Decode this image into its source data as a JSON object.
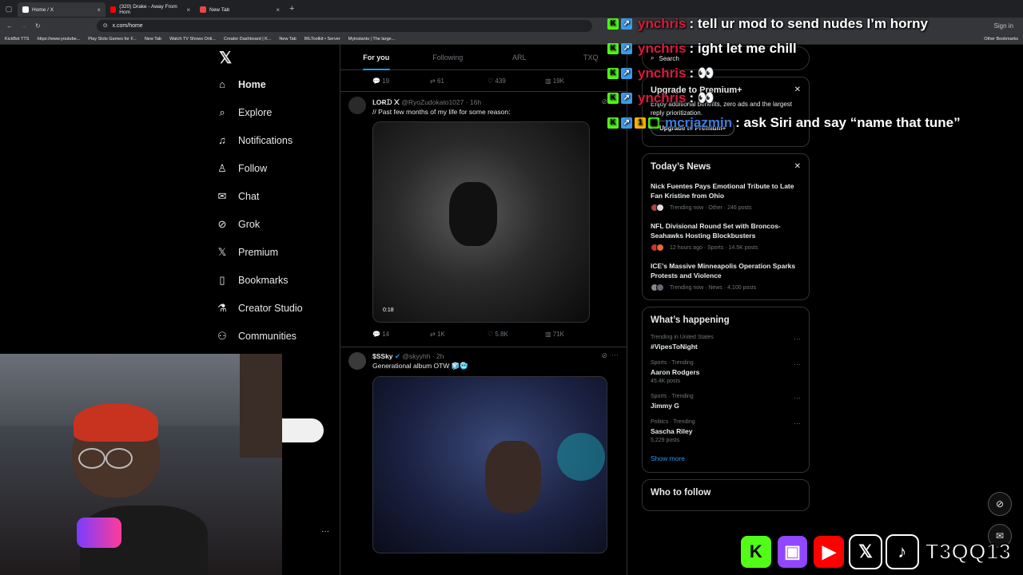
{
  "browser": {
    "tabs": [
      {
        "label": "Home / X",
        "active": true
      },
      {
        "label": "(320) Drake - Away From Hom",
        "active": false
      },
      {
        "label": "New Tab",
        "active": false
      }
    ],
    "url": "x.com/home",
    "bookmarks": [
      "KickBot TTS",
      "https://www.youtube...",
      "Play Slots Games for F...",
      "New Tab",
      "Watch TV Shows Onli...",
      "Creator Dashboard | K...",
      "New Tab",
      "IRLToolkit • Server",
      "Myinstants | The large..."
    ],
    "other_bookmarks": "Other Bookmarks",
    "sign_in": "Sign in"
  },
  "nav": {
    "items": [
      {
        "label": "Home",
        "icon": "home-icon"
      },
      {
        "label": "Explore",
        "icon": "search-icon"
      },
      {
        "label": "Notifications",
        "icon": "bell-icon"
      },
      {
        "label": "Follow",
        "icon": "person-add-icon"
      },
      {
        "label": "Chat",
        "icon": "mail-icon"
      },
      {
        "label": "Grok",
        "icon": "grok-icon"
      },
      {
        "label": "Premium",
        "icon": "x-icon"
      },
      {
        "label": "Bookmarks",
        "icon": "bookmark-icon"
      },
      {
        "label": "Creator Studio",
        "icon": "flask-icon"
      },
      {
        "label": "Communities",
        "icon": "people-icon"
      }
    ]
  },
  "feed": {
    "tabs": [
      "For you",
      "Following",
      "ARL",
      "TXQ"
    ],
    "top_actions": {
      "replies": "19",
      "reposts": "61",
      "likes": "439",
      "views": "19K"
    },
    "tweets": [
      {
        "name": "ᒪOɌᗪ ᙭",
        "handle": "@RyoZudokato1027 · 16h",
        "text": "// Past few months of my life for some reason:",
        "video_time": "0:18",
        "replies": "14",
        "reposts": "1K",
        "likes": "5.8K",
        "views": "71K"
      },
      {
        "name": "$SSky",
        "handle": "@skyyhh · 2h",
        "text": "Generational album OTW 🧊🥶"
      }
    ]
  },
  "right": {
    "search_placeholder": "Search",
    "premium": {
      "title": "Upgrade to Premium+",
      "body": "Enjoy additional benefits, zero ads and the largest reply prioritization.",
      "button": "Upgrade to Premium+"
    },
    "news": {
      "title": "Today’s News",
      "items": [
        {
          "title": "Nick Fuentes Pays Emotional Tribute to Late Fan Kristine from Ohio",
          "meta": "Trending now · Other · 246 posts"
        },
        {
          "title": "NFL Divisional Round Set with Broncos-Seahawks Hosting Blockbusters",
          "meta": "12 hours ago · Sports · 14.5K posts"
        },
        {
          "title": "ICE’s Massive Minneapolis Operation Sparks Protests and Violence",
          "meta": "Trending now · News · 4,100 posts"
        }
      ]
    },
    "happening": {
      "title": "What’s happening",
      "trends": [
        {
          "context": "Trending in United States",
          "name": "#VipesToNight",
          "posts": ""
        },
        {
          "context": "Sports · Trending",
          "name": "Aaron Rodgers",
          "posts": "45.4K posts"
        },
        {
          "context": "Sports · Trending",
          "name": "Jimmy G",
          "posts": ""
        },
        {
          "context": "Politics · Trending",
          "name": "Sascha Riley",
          "posts": "5,229 posts"
        }
      ],
      "show_more": "Show more"
    },
    "who_to_follow": "Who to follow"
  },
  "chat": [
    {
      "user": "ynchris",
      "msg": ": tell ur mod to send nudes I’m horny",
      "color": "#d81b3c"
    },
    {
      "user": "ynchris",
      "msg": ": ight let me chill",
      "color": "#d81b3c"
    },
    {
      "user": "ynchris",
      "msg": ": 👀",
      "color": "#d81b3c"
    },
    {
      "user": "ynchris",
      "msg": ": 👀",
      "color": "#d81b3c"
    },
    {
      "user": "mcrjazmin",
      "msg": ": ask Siri and say “name that tune”",
      "color": "#3d7bd9"
    }
  ],
  "stream": {
    "channel": "T3QQ13",
    "socials": [
      "kick-icon",
      "twitch-icon",
      "youtube-icon",
      "x-icon",
      "tiktok-icon"
    ]
  }
}
